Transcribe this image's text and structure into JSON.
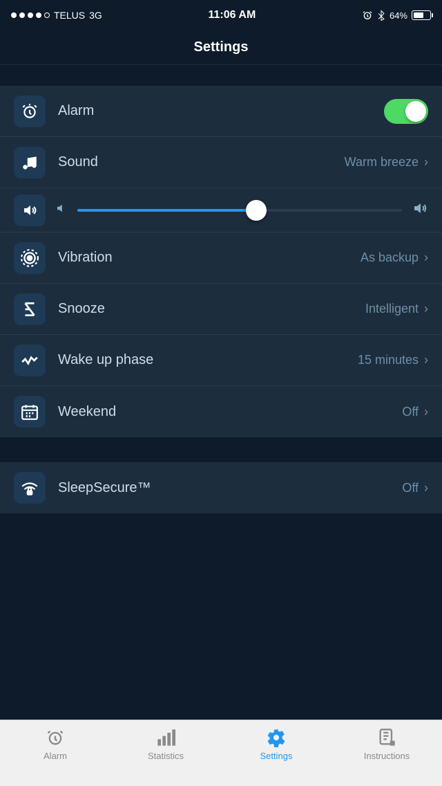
{
  "statusBar": {
    "carrier": "TELUS",
    "network": "3G",
    "time": "11:06 AM",
    "batteryPercent": "64%"
  },
  "nav": {
    "title": "Settings"
  },
  "settings": {
    "rows": [
      {
        "id": "alarm",
        "label": "Alarm",
        "type": "toggle",
        "toggleOn": true,
        "icon": "alarm-icon"
      },
      {
        "id": "sound",
        "label": "Sound",
        "value": "Warm breeze",
        "type": "nav",
        "icon": "music-icon"
      },
      {
        "id": "volume",
        "label": "Volume",
        "type": "slider",
        "fillPercent": 55,
        "icon": "volume-icon"
      },
      {
        "id": "vibration",
        "label": "Vibration",
        "value": "As backup",
        "type": "nav",
        "icon": "vibration-icon"
      },
      {
        "id": "snooze",
        "label": "Snooze",
        "value": "Intelligent",
        "type": "nav",
        "icon": "snooze-icon"
      },
      {
        "id": "wakeup",
        "label": "Wake up phase",
        "value": "15 minutes",
        "type": "nav",
        "icon": "wakeup-icon"
      },
      {
        "id": "weekend",
        "label": "Weekend",
        "value": "Off",
        "type": "nav",
        "icon": "weekend-icon"
      }
    ],
    "sleepSecure": {
      "label": "SleepSecure™",
      "value": "Off",
      "icon": "sleepsecure-icon"
    }
  },
  "tabBar": {
    "items": [
      {
        "id": "alarm-tab",
        "label": "Alarm",
        "active": false,
        "icon": "alarm-tab-icon"
      },
      {
        "id": "statistics-tab",
        "label": "Statistics",
        "active": false,
        "icon": "statistics-tab-icon"
      },
      {
        "id": "settings-tab",
        "label": "Settings",
        "active": true,
        "icon": "settings-tab-icon"
      },
      {
        "id": "instructions-tab",
        "label": "Instructions",
        "active": false,
        "icon": "instructions-tab-icon"
      }
    ]
  }
}
